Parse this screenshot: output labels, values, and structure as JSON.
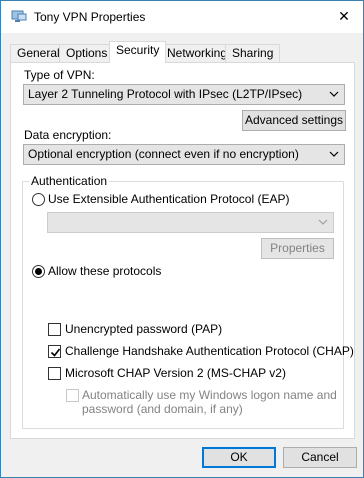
{
  "window": {
    "title": "Tony VPN Properties",
    "close_glyph": "✕"
  },
  "tabs": [
    {
      "label": "General"
    },
    {
      "label": "Options"
    },
    {
      "label": "Security"
    },
    {
      "label": "Networking"
    },
    {
      "label": "Sharing"
    }
  ],
  "active_tab": "Security",
  "security": {
    "type_label": "Type of VPN:",
    "type_value": "Layer 2 Tunneling Protocol with IPsec (L2TP/IPsec)",
    "advanced_label": "Advanced settings",
    "encryption_label": "Data encryption:",
    "encryption_value": "Optional encryption (connect even if no encryption)",
    "auth": {
      "legend": "Authentication",
      "eap_label": "Use Extensible Authentication Protocol (EAP)",
      "eap_selected": false,
      "eap_value": "",
      "properties_label": "Properties",
      "allow_label": "Allow these protocols",
      "allow_selected": true,
      "protocols": [
        {
          "label": "Unencrypted password (PAP)",
          "checked": false
        },
        {
          "label": "Challenge Handshake Authentication Protocol (CHAP)",
          "checked": true
        },
        {
          "label": "Microsoft CHAP Version 2 (MS-CHAP v2)",
          "checked": false
        }
      ],
      "auto_logon_line1": "Automatically use my Windows logon name and",
      "auto_logon_line2": "password (and domain, if any)",
      "auto_logon_checked": false
    }
  },
  "footer": {
    "ok_label": "OK",
    "cancel_label": "Cancel"
  }
}
